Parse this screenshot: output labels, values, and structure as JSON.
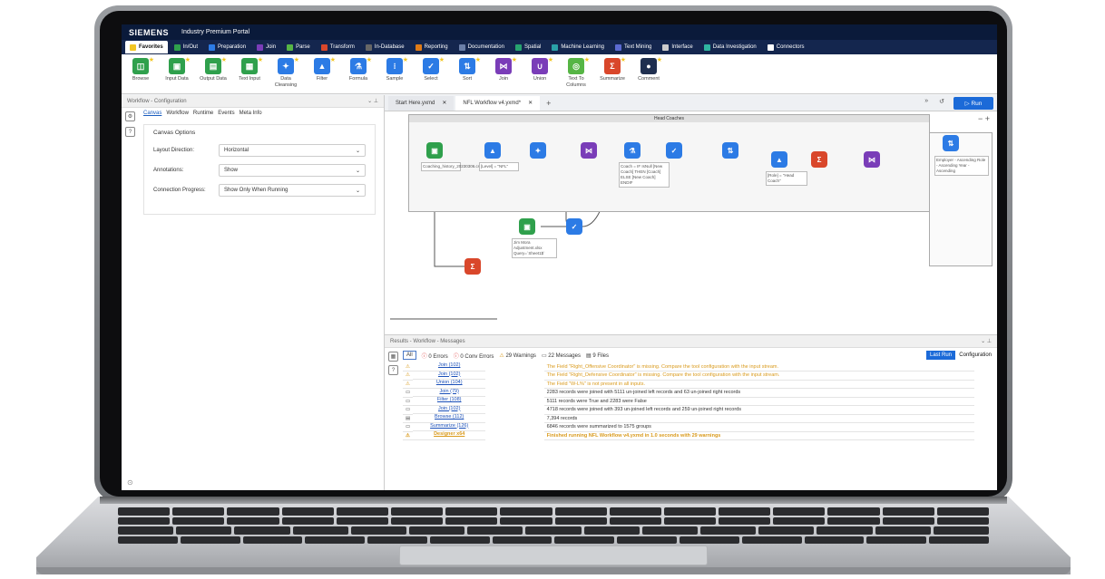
{
  "app": {
    "brand": "SIEMENS",
    "title": "Industry Premium Portal"
  },
  "tabs": [
    {
      "label": "Favorites",
      "color": "#f3c623"
    },
    {
      "label": "In/Out",
      "color": "#2fa04c"
    },
    {
      "label": "Preparation",
      "color": "#2c7be5"
    },
    {
      "label": "Join",
      "color": "#7a3db8"
    },
    {
      "label": "Parse",
      "color": "#56b545"
    },
    {
      "label": "Transform",
      "color": "#d9472b"
    },
    {
      "label": "In-Database",
      "color": "#666666"
    },
    {
      "label": "Reporting",
      "color": "#e07b17"
    },
    {
      "label": "Documentation",
      "color": "#6b7fa8"
    },
    {
      "label": "Spatial",
      "color": "#27a36f"
    },
    {
      "label": "Machine Learning",
      "color": "#2aa0a8"
    },
    {
      "label": "Text Mining",
      "color": "#5b6ad0"
    },
    {
      "label": "Interface",
      "color": "#cccccc"
    },
    {
      "label": "Data Investigation",
      "color": "#2fb5a0"
    },
    {
      "label": "Connectors",
      "color": "#ffffff"
    }
  ],
  "tools": [
    {
      "label": "Browse",
      "icon": "browse-icon",
      "color": "#2fa04c",
      "glyph": "◫"
    },
    {
      "label": "Input Data",
      "icon": "input-data-icon",
      "color": "#2fa04c",
      "glyph": "▣"
    },
    {
      "label": "Output Data",
      "icon": "output-data-icon",
      "color": "#2fa04c",
      "glyph": "▤"
    },
    {
      "label": "Text Input",
      "icon": "text-input-icon",
      "color": "#2fa04c",
      "glyph": "▦"
    },
    {
      "label": "Data Cleansing",
      "icon": "data-cleansing-icon",
      "color": "#2c7be5",
      "glyph": "✦"
    },
    {
      "label": "Filter",
      "icon": "filter-icon",
      "color": "#2c7be5",
      "glyph": "▲"
    },
    {
      "label": "Formula",
      "icon": "formula-icon",
      "color": "#2c7be5",
      "glyph": "⚗"
    },
    {
      "label": "Sample",
      "icon": "sample-icon",
      "color": "#2c7be5",
      "glyph": "⁝"
    },
    {
      "label": "Select",
      "icon": "select-icon",
      "color": "#2c7be5",
      "glyph": "✓"
    },
    {
      "label": "Sort",
      "icon": "sort-icon",
      "color": "#2c7be5",
      "glyph": "⇅"
    },
    {
      "label": "Join",
      "icon": "join-icon",
      "color": "#7a3db8",
      "glyph": "⋈"
    },
    {
      "label": "Union",
      "icon": "union-icon",
      "color": "#7a3db8",
      "glyph": "∪"
    },
    {
      "label": "Text To Columns",
      "icon": "text-to-columns-icon",
      "color": "#56b545",
      "glyph": "◎"
    },
    {
      "label": "Summarize",
      "icon": "summarize-icon",
      "color": "#d9472b",
      "glyph": "Σ"
    },
    {
      "label": "Comment",
      "icon": "comment-icon",
      "color": "#1f2f4f",
      "glyph": "●"
    }
  ],
  "config": {
    "panel_title": "Workflow - Configuration",
    "subtabs": [
      "Canvas",
      "Workflow",
      "Runtime",
      "Events",
      "Meta Info"
    ],
    "options_title": "Canvas Options",
    "options": [
      {
        "label": "Layout Direction:",
        "value": "Horizontal"
      },
      {
        "label": "Annotations:",
        "value": "Show"
      },
      {
        "label": "Connection Progress:",
        "value": "Show Only When Running"
      }
    ]
  },
  "doctabs": [
    {
      "label": "Start Here.yxmd"
    },
    {
      "label": "NFL Workflow v4.yxmd*"
    }
  ],
  "run_label": "Run",
  "canvas": {
    "container_title": "Head Coaches",
    "annotations": {
      "input1": "Coaching_history_20230306.csv",
      "filter1": "[Level] = \"NFL\"",
      "formula1": "Coach = IF IsNull [New Coach] THEN [Coach] ELSE [New Coach] ENDIF",
      "filter2": "[Role] = \"Head Coach\"",
      "sort1": "Employer - Ascending Role - Ascending Year - Ascending",
      "input2": "Jim Mora Adjustment.xlsx Query=`Sheet1$`"
    }
  },
  "results": {
    "title": "Results - Workflow - Messages",
    "filters": {
      "all": "All",
      "errors": "0 Errors",
      "conv_errors": "0 Conv Errors",
      "warnings": "29 Warnings",
      "messages": "22 Messages",
      "files": "9 Files"
    },
    "last_run": "Last Run",
    "configuration": "Configuration",
    "rows": [
      {
        "icon": "warning-icon",
        "tool": "Join (102)",
        "msg": "The Field \"Right_Offensive Coordinator\" is missing. Compare the tool configuration with the input stream.",
        "type": "warn"
      },
      {
        "icon": "warning-icon",
        "tool": "Join (102)",
        "msg": "The Field \"Right_Defensive Coordinator\" is missing. Compare the tool configuration with the input stream.",
        "type": "warn"
      },
      {
        "icon": "warning-icon",
        "tool": "Union (104)",
        "msg": "The Field \"W-L%\" is not present in all inputs.",
        "type": "warn"
      },
      {
        "icon": "message-icon",
        "tool": "Join (79)",
        "msg": "2283 records were joined with 5111 un-joined left records and 63 un-joined right records",
        "type": "info"
      },
      {
        "icon": "message-icon",
        "tool": "Filter (108)",
        "msg": "5111 records were True and 2283 were False",
        "type": "info"
      },
      {
        "icon": "message-icon",
        "tool": "Join (102)",
        "msg": "4718 records were joined with 393 un-joined left records and 259 un-joined right records",
        "type": "info"
      },
      {
        "icon": "file-icon",
        "tool": "Browse (112)",
        "msg": "7,394 records",
        "type": "info"
      },
      {
        "icon": "message-icon",
        "tool": "Summarize (126)",
        "msg": "6846 records were summarized to 1575 groups",
        "type": "info"
      },
      {
        "icon": "warning-icon",
        "tool": "Designer x64",
        "msg": "Finished running NFL Workflow v4.yxmd in 1.0 seconds with 29 warnings",
        "type": "bold"
      }
    ]
  }
}
